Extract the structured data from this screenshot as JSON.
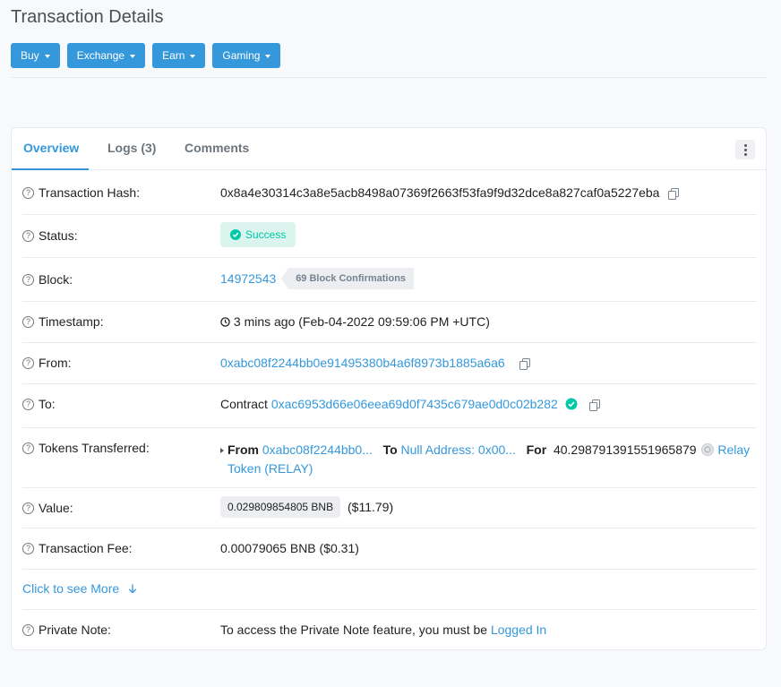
{
  "page": {
    "title": "Transaction Details"
  },
  "top_buttons": [
    "Buy",
    "Exchange",
    "Earn",
    "Gaming"
  ],
  "tabs": [
    "Overview",
    "Logs (3)",
    "Comments"
  ],
  "rows": {
    "tx_hash": {
      "label": "Transaction Hash:",
      "value": "0x8a4e30314c3a8e5acb8498a07369f2663f53fa9f9d32dce8a827caf0a5227eba"
    },
    "status": {
      "label": "Status:",
      "value": "Success"
    },
    "block": {
      "label": "Block:",
      "number": "14972543",
      "confirmations": "69 Block Confirmations"
    },
    "timestamp": {
      "label": "Timestamp:",
      "value": "3 mins ago (Feb-04-2022 09:59:06 PM +UTC)"
    },
    "from": {
      "label": "From:",
      "value": "0xabc08f2244bb0e91495380b4a6f8973b1885a6a6"
    },
    "to": {
      "label": "To:",
      "prefix": "Contract",
      "value": "0xac6953d66e06eea69d0f7435c679ae0d0c02b282"
    },
    "tokens": {
      "label": "Tokens Transferred:",
      "from_label": "From",
      "from_value": "0xabc08f2244bb0...",
      "to_label": "To",
      "to_value": "Null Address: 0x00...",
      "for_label": "For",
      "amount": "40.298791391551965879",
      "token_name": "Relay",
      "token_line2": "Token (RELAY)"
    },
    "value": {
      "label": "Value:",
      "amount": "0.029809854805 BNB",
      "usd": "($11.79)"
    },
    "fee": {
      "label": "Transaction Fee:",
      "value": "0.00079065 BNB ($0.31)"
    },
    "see_more": "Click to see More",
    "private_note": {
      "label": "Private Note:",
      "text": "To access the Private Note feature, you must be",
      "link": "Logged In"
    }
  },
  "colors": {
    "accent": "#3498db",
    "success": "#00c9a7",
    "success_bg": "#dbf5ee"
  }
}
